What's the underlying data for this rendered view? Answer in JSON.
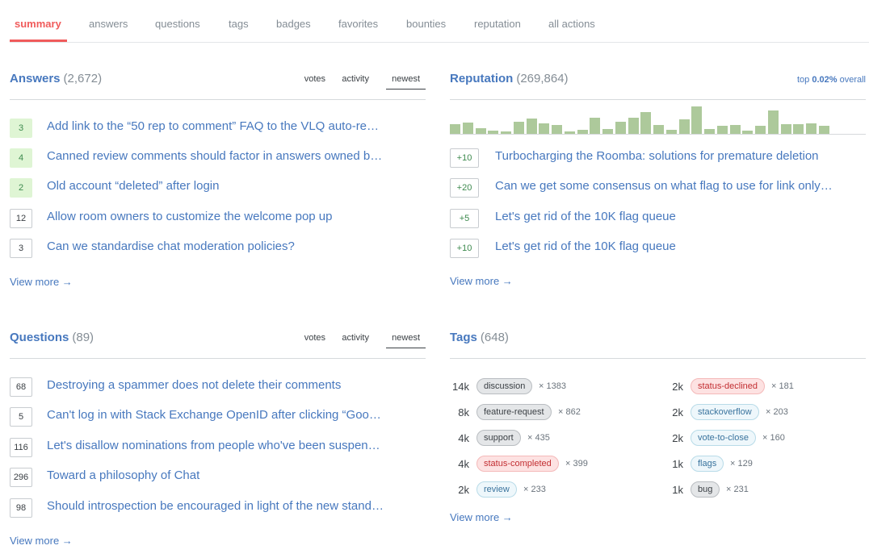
{
  "nav": {
    "tabs": [
      {
        "label": "summary",
        "active": true
      },
      {
        "label": "answers"
      },
      {
        "label": "questions"
      },
      {
        "label": "tags"
      },
      {
        "label": "badges"
      },
      {
        "label": "favorites"
      },
      {
        "label": "bounties"
      },
      {
        "label": "reputation"
      },
      {
        "label": "all actions"
      }
    ]
  },
  "answers": {
    "title": "Answers",
    "count": "(2,672)",
    "sort": [
      "votes",
      "activity",
      "newest"
    ],
    "active_sort": "newest",
    "items": [
      {
        "score": "3",
        "accepted": true,
        "title": "Add link to the “50 rep to comment” FAQ to the VLQ auto-re…"
      },
      {
        "score": "4",
        "accepted": true,
        "title": "Canned review comments should factor in answers owned b…"
      },
      {
        "score": "2",
        "accepted": true,
        "title": "Old account “deleted” after login"
      },
      {
        "score": "12",
        "accepted": false,
        "title": "Allow room owners to customize the welcome pop up"
      },
      {
        "score": "3",
        "accepted": false,
        "title": "Can we standardise chat moderation policies?"
      }
    ],
    "view_more": "View more →"
  },
  "reputation": {
    "title": "Reputation",
    "count": "(269,864)",
    "top_prefix": "top",
    "top_value": "0.02%",
    "top_suffix": "overall",
    "items": [
      {
        "change": "+10",
        "title": "Turbocharging the Roomba: solutions for premature deletion"
      },
      {
        "change": "+20",
        "title": "Can we get some consensus on what flag to use for link only…"
      },
      {
        "change": "+5",
        "title": "Let's get rid of the 10K flag queue"
      },
      {
        "change": "+10",
        "title": "Let's get rid of the 10K flag queue"
      }
    ],
    "view_more": "View more →"
  },
  "chart_data": {
    "type": "bar",
    "title": "",
    "xlabel": "",
    "ylabel": "",
    "categories": [
      "1",
      "2",
      "3",
      "4",
      "5",
      "6",
      "7",
      "8",
      "9",
      "10",
      "11",
      "12",
      "13",
      "14",
      "15",
      "16",
      "17",
      "18",
      "19",
      "20",
      "21",
      "22",
      "23",
      "24",
      "25",
      "26",
      "27",
      "28",
      "29",
      "30"
    ],
    "values": [
      12,
      14,
      7,
      4,
      3,
      15,
      19,
      13,
      11,
      3,
      5,
      20,
      6,
      15,
      20,
      27,
      11,
      5,
      18,
      34,
      6,
      10,
      11,
      4,
      10,
      29,
      12,
      12,
      13,
      10
    ],
    "ylim": [
      0,
      34
    ],
    "grid": false,
    "color": "#adc99b"
  },
  "questions": {
    "title": "Questions",
    "count": "(89)",
    "sort": [
      "votes",
      "activity",
      "newest"
    ],
    "active_sort": "newest",
    "items": [
      {
        "score": "68",
        "title": "Destroying a spammer does not delete their comments"
      },
      {
        "score": "5",
        "title": "Can't log in with Stack Exchange OpenID after clicking “Goo…"
      },
      {
        "score": "116",
        "title": "Let's disallow nominations from people who've been suspen…"
      },
      {
        "score": "296",
        "title": "Toward a philosophy of Chat"
      },
      {
        "score": "98",
        "title": "Should introspection be encouraged in light of the new stand…"
      }
    ],
    "view_more": "View more →"
  },
  "tags": {
    "title": "Tags",
    "count": "(648)",
    "left": [
      {
        "score": "14k",
        "name": "discussion",
        "style": "gray",
        "count": "× 1383"
      },
      {
        "score": "8k",
        "name": "feature-request",
        "style": "gray",
        "count": "× 862"
      },
      {
        "score": "4k",
        "name": "support",
        "style": "gray",
        "count": "× 435"
      },
      {
        "score": "4k",
        "name": "status-completed",
        "style": "red",
        "count": "× 399"
      },
      {
        "score": "2k",
        "name": "review",
        "style": "blue",
        "count": "× 233"
      }
    ],
    "right": [
      {
        "score": "2k",
        "name": "status-declined",
        "style": "red",
        "count": "× 181"
      },
      {
        "score": "2k",
        "name": "stackoverflow",
        "style": "blue",
        "count": "× 203"
      },
      {
        "score": "2k",
        "name": "vote-to-close",
        "style": "blue",
        "count": "× 160"
      },
      {
        "score": "1k",
        "name": "flags",
        "style": "blue",
        "count": "× 129"
      },
      {
        "score": "1k",
        "name": "bug",
        "style": "gray",
        "count": "× 231"
      }
    ],
    "view_more": "View more →"
  }
}
